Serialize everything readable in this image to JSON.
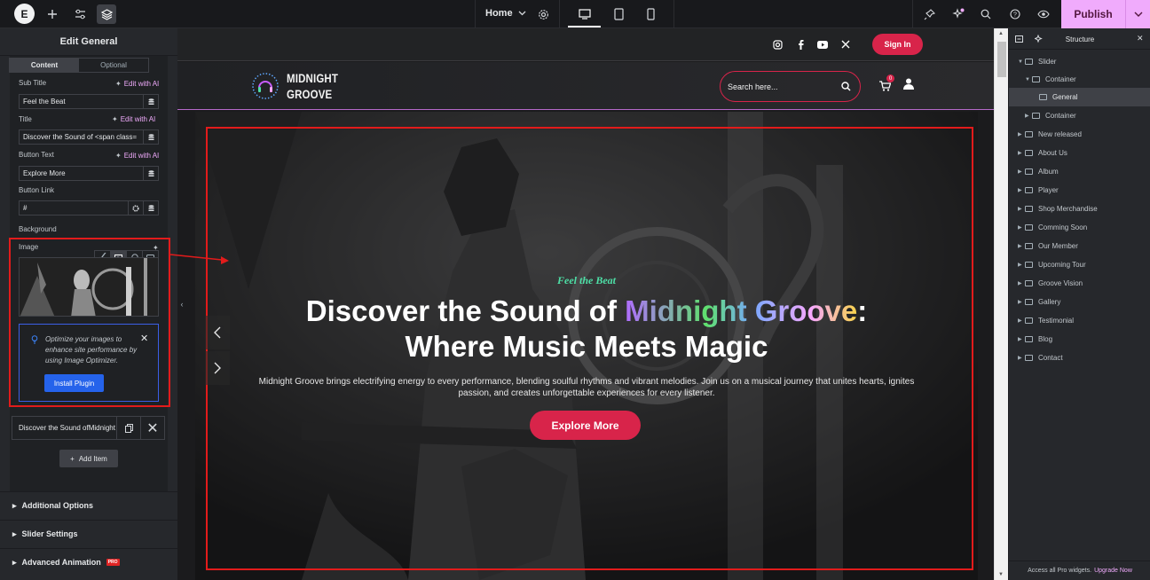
{
  "topbar": {
    "logo_text": "E",
    "page_select": "Home",
    "publish_label": "Publish",
    "icons": [
      "elementor-logo-icon",
      "add-icon",
      "settings-sliders-icon",
      "layers-icon",
      "gear-icon",
      "desktop-icon",
      "tablet-icon",
      "mobile-icon",
      "pin-icon",
      "sparkle-notification-icon",
      "search-icon",
      "help-icon",
      "preview-eye-icon",
      "chevron-down-icon"
    ]
  },
  "left_panel": {
    "header": "Edit General",
    "tabs": [
      "Content",
      "Optional"
    ],
    "fields": {
      "sub_title_label": "Sub Title",
      "sub_title_value": "Feel the Beat",
      "title_label": "Title",
      "title_value": "Discover the Sound of <span class=",
      "button_text_label": "Button Text",
      "button_text_value": "Explore More",
      "button_link_label": "Button Link",
      "button_link_value": "#",
      "background_label": "Background",
      "image_label": "Image",
      "edit_ai": "Edit with AI"
    },
    "notice": {
      "text": "Optimize your images to enhance site performance by using Image Optimizer.",
      "button": "Install Plugin"
    },
    "repeater_item": "Discover the Sound ofMidnight G",
    "add_item": "Add Item",
    "sections": [
      "Additional Options",
      "Slider Settings",
      "Advanced Animation"
    ],
    "pro_badge": "PRO"
  },
  "site": {
    "signin": "Sign In",
    "brand_line1": "MIDNIGHT",
    "brand_line2": "GROOVE",
    "search_placeholder": "Search here...",
    "cart_count": "0",
    "social_icons": [
      "instagram-icon",
      "facebook-icon",
      "youtube-icon",
      "x-icon"
    ]
  },
  "hero": {
    "subtitle": "Feel the Beat",
    "title_part1": "Discover the Sound of ",
    "title_highlight": "Midnight Groove",
    "title_part2": ":",
    "title_line2": "Where Music Meets Magic",
    "description": "Midnight Groove brings electrifying energy to every performance, blending soulful rhythms and vibrant melodies. Join us on a musical journey that unites hearts, ignites passion, and creates unforgettable experiences for every listener.",
    "button": "Explore More"
  },
  "structure_panel": {
    "title": "Structure",
    "items": [
      {
        "label": "Slider",
        "depth": 0,
        "expanded": true
      },
      {
        "label": "Container",
        "depth": 1,
        "expanded": true
      },
      {
        "label": "General",
        "depth": 2,
        "selected": true
      },
      {
        "label": "Container",
        "depth": 1,
        "expanded": false
      },
      {
        "label": "New released",
        "depth": 0
      },
      {
        "label": "About Us",
        "depth": 0
      },
      {
        "label": "Album",
        "depth": 0
      },
      {
        "label": "Player",
        "depth": 0
      },
      {
        "label": "Shop Merchandise",
        "depth": 0
      },
      {
        "label": "Comming Soon",
        "depth": 0
      },
      {
        "label": "Our Member",
        "depth": 0
      },
      {
        "label": "Upcoming Tour",
        "depth": 0
      },
      {
        "label": "Groove Vision",
        "depth": 0
      },
      {
        "label": "Gallery",
        "depth": 0
      },
      {
        "label": "Testimonial",
        "depth": 0
      },
      {
        "label": "Blog",
        "depth": 0
      },
      {
        "label": "Contact",
        "depth": 0
      }
    ],
    "footer_text": "Access all Pro widgets.",
    "footer_link": "Upgrade Now"
  },
  "colors": {
    "accent_pink": "#f0abfc",
    "brand_red": "#d8244a",
    "annotation_red": "#e21b1b",
    "info_blue": "#2563eb"
  }
}
